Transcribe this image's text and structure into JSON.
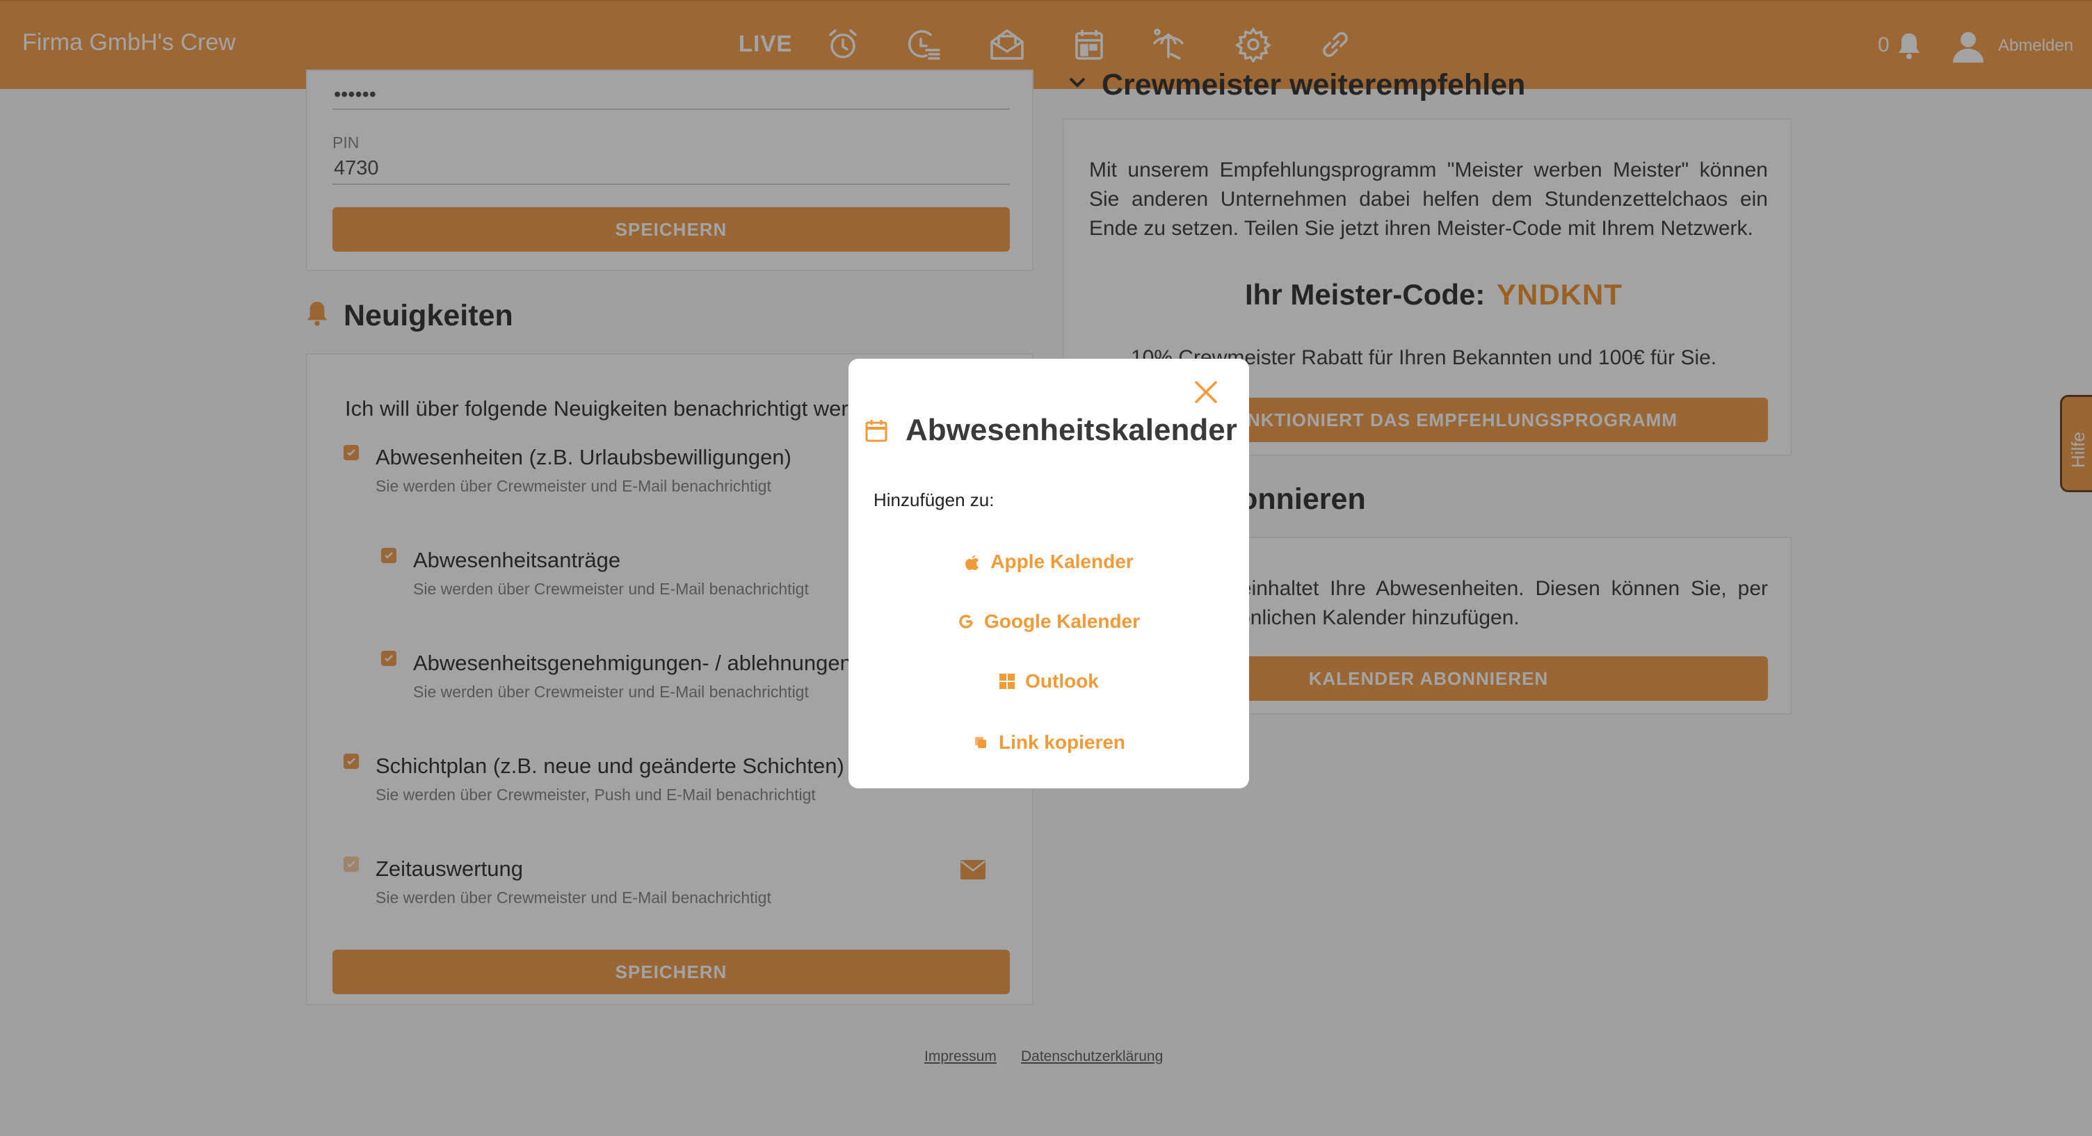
{
  "header": {
    "brand": "Firma GmbH's Crew",
    "live_label": "LIVE",
    "nav_icons": [
      "alarm-clock-icon",
      "timesheet-list-icon",
      "mail-open-icon",
      "calendar-icon",
      "vacation-umbrella-icon",
      "settings-gear-icon",
      "link-icon"
    ],
    "notification_count": "0",
    "logout_label": "Abmelden",
    "accent_color": "#f2a253"
  },
  "login_card": {
    "password_value": "••••••",
    "pin_label": "PIN",
    "pin_value": "4730",
    "save_label": "SPEICHERN"
  },
  "news": {
    "title": "Neuigkeiten",
    "intro": "Ich will über folgende Neuigkeiten benachrichtigt werden:",
    "options": [
      {
        "title": "Abwesenheiten (z.B. Urlaubsbewilligungen)",
        "sub": "Sie werden über Crewmeister und E-Mail benachrichtigt",
        "checked": true
      },
      {
        "title": "Abwesenheitsanträge",
        "sub": "Sie werden über Crewmeister und E-Mail benachrichtigt",
        "checked": true
      },
      {
        "title": "Abwesenheitsgenehmigungen- / ablehnungen",
        "sub": "Sie werden über Crewmeister und E-Mail benachrichtigt",
        "checked": true
      },
      {
        "title": "Schichtplan (z.B. neue und geänderte Schichten)",
        "sub": "Sie werden über Crewmeister, Push und E-Mail benachrichtigt",
        "checked": true
      },
      {
        "title": "Zeitauswertung",
        "sub": "Sie werden über Crewmeister und E-Mail benachrichtigt",
        "checked": true
      }
    ],
    "save_label": "SPEICHERN"
  },
  "referral": {
    "title": "Crewmeister weiterempfehlen",
    "text": "Mit unserem Empfehlungsprogramm \"Meister werben Meister\" können Sie anderen Unternehmen dabei helfen dem Stundenzettelchaos ein Ende zu setzen. Teilen Sie jetzt ihren Meister-Code mit Ihrem Netzwerk.",
    "code_label": "Ihr Meister-Code:",
    "code_value": "YNDKNT",
    "discount": "10% Crewmeister Rabatt für Ihren Bekannten und 100€ für Sie.",
    "how_button": "WIE FUNKTIONIERT DAS EMPFEHLUNGSPROGRAMM"
  },
  "calendar_sub": {
    "title": "Kalender abonnieren",
    "text": "Der Kalender beinhaltet Ihre Abwesenheiten. Diesen können Sie, per Link, Ihrem persönlichen Kalender hinzufügen.",
    "button": "KALENDER ABONNIEREN"
  },
  "help_tab": "Hilfe",
  "footer": {
    "impressum": "Impressum",
    "privacy": "Datenschutzerklärung"
  },
  "modal": {
    "title": "Abwesenheitskalender",
    "subtitle": "Hinzufügen zu:",
    "options": [
      {
        "label": "Apple Kalender",
        "icon": "apple-icon"
      },
      {
        "label": "Google Kalender",
        "icon": "google-icon"
      },
      {
        "label": "Outlook",
        "icon": "windows-icon"
      },
      {
        "label": "Link kopieren",
        "icon": "copy-icon"
      }
    ]
  }
}
